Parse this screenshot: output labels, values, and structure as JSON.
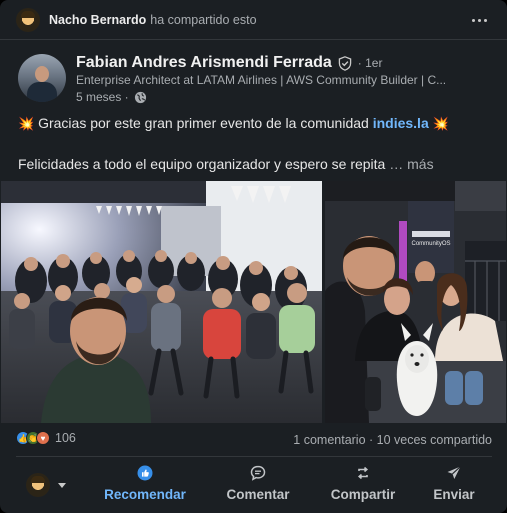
{
  "shared": {
    "actor_name": "Nacho Bernardo",
    "action_text": "ha compartido esto"
  },
  "author": {
    "name": "Fabian Andres Arismendi Ferrada",
    "degree": "· 1er",
    "headline": "Enterprise Architect at LATAM Airlines | AWS Community Builder | C...",
    "time": "5 meses ·"
  },
  "post": {
    "line1_prefix": "Gracias por este gran primer evento de la comunidad",
    "line1_link": "indies.la",
    "line2": "Felicidades a todo el equipo organizador y espero se repita",
    "see_more": "… más"
  },
  "images": {
    "right_sign_text": "CommunityOS"
  },
  "social": {
    "reaction_count": "106",
    "comments": "1 comentario",
    "separator": " · ",
    "shares": "10 veces compartido"
  },
  "actions": {
    "like": "Recomendar",
    "comment": "Comentar",
    "repost": "Compartir",
    "send": "Enviar"
  },
  "colors": {
    "background": "#1b1f23",
    "accent": "#71b7fb",
    "muted_text": "#a9adb1"
  }
}
